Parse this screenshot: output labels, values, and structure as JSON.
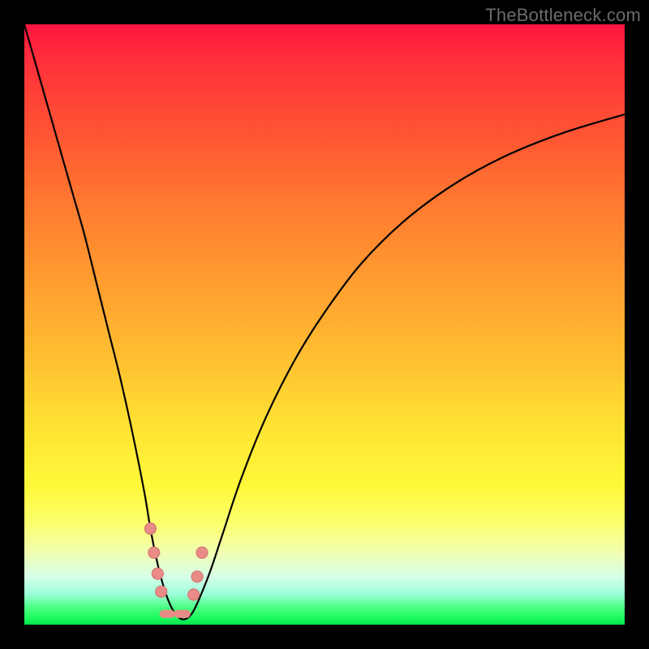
{
  "watermark": "TheBottleneck.com",
  "chart_data": {
    "type": "line",
    "title": "",
    "xlabel": "",
    "ylabel": "",
    "ylim": [
      0,
      100
    ],
    "xlim": [
      0,
      100
    ],
    "series": [
      {
        "name": "bottleneck-curve",
        "x": [
          0,
          2,
          4,
          6,
          8,
          10,
          12,
          14,
          16,
          18,
          20,
          21,
          22,
          23,
          24,
          25,
          26,
          27,
          28,
          29,
          31,
          33,
          36,
          40,
          45,
          50,
          56,
          63,
          71,
          80,
          90,
          100
        ],
        "values": [
          100,
          93,
          86,
          79,
          72,
          65,
          57,
          49,
          41,
          32,
          22,
          16,
          11,
          7,
          4,
          2,
          1,
          1,
          2,
          4,
          9,
          15,
          24,
          34,
          44,
          52,
          60,
          67,
          73,
          78,
          82,
          85
        ]
      }
    ],
    "markers": {
      "left_leg": [
        {
          "x": 21,
          "y": 16
        },
        {
          "x": 21.6,
          "y": 12
        },
        {
          "x": 22.2,
          "y": 8.5
        },
        {
          "x": 22.8,
          "y": 5.5
        }
      ],
      "right_leg": [
        {
          "x": 28.2,
          "y": 5
        },
        {
          "x": 28.8,
          "y": 8
        },
        {
          "x": 29.6,
          "y": 12
        }
      ],
      "bottom_caps": [
        {
          "x0": 23.2,
          "x1": 24.4,
          "y": 1.8
        },
        {
          "x0": 25.6,
          "x1": 27.0,
          "y": 1.8
        }
      ]
    },
    "colors": {
      "gradient_top": "#ff1540",
      "gradient_bottom": "#06e24b",
      "curve": "#000000",
      "marker": "#e98b87"
    }
  }
}
